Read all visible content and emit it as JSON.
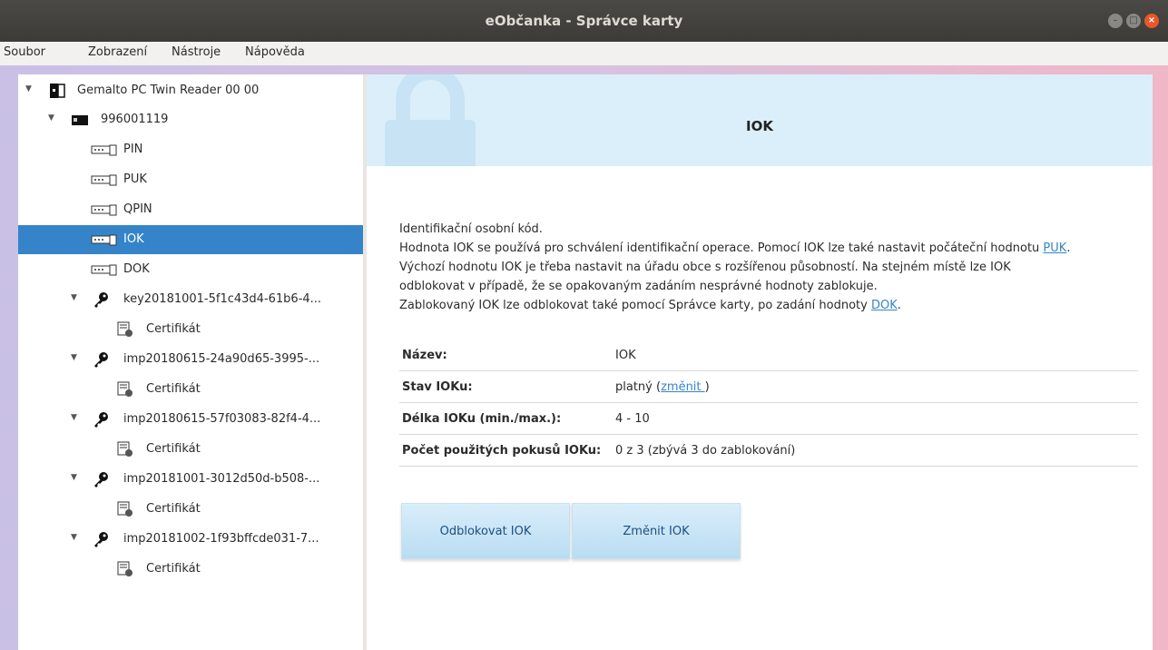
{
  "window": {
    "title": "eObčanka - Správce karty"
  },
  "menubar": [
    "Soubor",
    "Zobrazení",
    "Nástroje",
    "Nápověda"
  ],
  "tree": {
    "reader": "Gemalto PC Twin Reader 00 00",
    "card": "996001119",
    "codes": [
      "PIN",
      "PUK",
      "QPIN",
      "IOK",
      "DOK"
    ],
    "selected": "IOK",
    "keys": [
      {
        "label": "key20181001-5f1c43d4-61b6-4...",
        "child": "Certifikát"
      },
      {
        "label": "imp20180615-24a90d65-3995-...",
        "child": "Certifikát"
      },
      {
        "label": "imp20180615-57f03083-82f4-4...",
        "child": "Certifikát"
      },
      {
        "label": "imp20181001-3012d50d-b508-...",
        "child": "Certifikát"
      },
      {
        "label": "imp20181002-1f93bffcde031-7...",
        "child": "Certifikát"
      }
    ]
  },
  "main": {
    "title": "IOK",
    "desc": {
      "line1": "Identifikační osobní kód.",
      "line2_pre": "Hodnota IOK se používá pro schválení identifikační operace. Pomocí IOK lze také nastavit počáteční hodnotu ",
      "line2_link": "PUK",
      "line2_post": ".",
      "line3": "Výchozí hodnotu IOK je třeba nastavit na úřadu obce s rozšířenou působností. Na stejném místě lze IOK",
      "line4": "odblokovat v případě, že se opakovaným zadáním nesprávné hodnoty zablokuje.",
      "line5_pre": "Zablokovaný IOK lze odblokovat také pomocí Správce karty, po zadání hodnoty ",
      "line5_link": "DOK",
      "line5_post": "."
    },
    "props": [
      {
        "key": "Název:",
        "value": "IOK"
      },
      {
        "key": "Stav IOKu:",
        "value_pre": "platný (",
        "value_link": "změnit ",
        "value_post": ")"
      },
      {
        "key": "Délka IOKu (min./max.):",
        "value": "4 - 10"
      },
      {
        "key": "Počet použitých pokusů IOKu:",
        "value": "0 z 3 (zbývá 3 do zablokování)"
      }
    ],
    "buttons": {
      "unblock": "Odblokovat IOK",
      "change": "Změnit IOK"
    }
  },
  "colors": {
    "selection": "#3584c9",
    "banner": "#dbeffa",
    "link": "#3584c9",
    "button": "#c3e2f6"
  },
  "icons": {
    "reader": "card-reader-icon",
    "card": "smart-card-icon",
    "code": "code-keypad-icon",
    "key": "key-icon",
    "certificate": "certificate-icon",
    "banner": "lock-icon"
  }
}
